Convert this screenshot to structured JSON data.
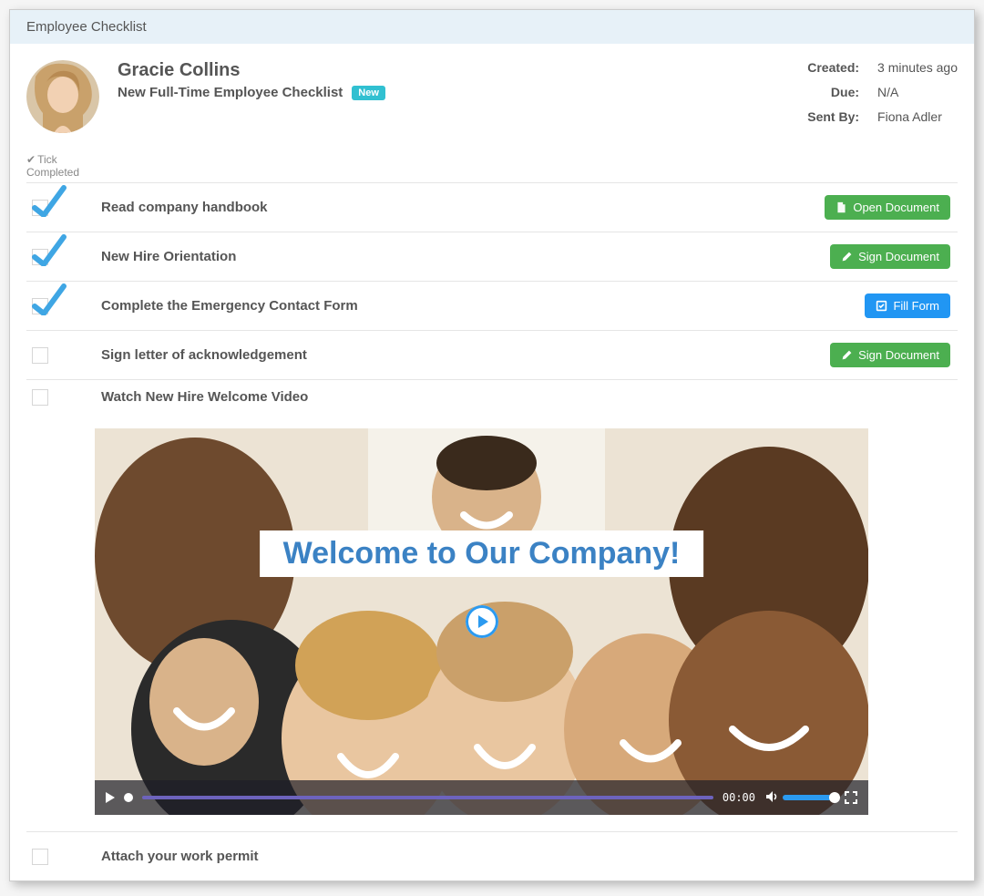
{
  "header": {
    "title": "Employee Checklist"
  },
  "profile": {
    "name": "Gracie Collins",
    "checklist_title": "New Full-Time Employee Checklist",
    "badge": "New"
  },
  "meta": {
    "created_label": "Created:",
    "created_value": "3 minutes ago",
    "due_label": "Due:",
    "due_value": "N/A",
    "sentby_label": "Sent By:",
    "sentby_value": "Fiona Adler"
  },
  "tick_col": {
    "line1": "Tick",
    "line2": "Completed"
  },
  "items": [
    {
      "title": "Read company handbook",
      "action": "Open Document",
      "action_style": "green",
      "action_icon": "file",
      "checked": true
    },
    {
      "title": "New Hire Orientation",
      "action": "Sign Document",
      "action_style": "green",
      "action_icon": "pencil",
      "checked": true
    },
    {
      "title": "Complete the Emergency Contact Form",
      "action": "Fill Form",
      "action_style": "blue",
      "action_icon": "form",
      "checked": true
    },
    {
      "title": "Sign letter of acknowledgement",
      "action": "Sign Document",
      "action_style": "green",
      "action_icon": "pencil",
      "checked": false
    },
    {
      "title": "Watch New Hire Welcome Video",
      "checked": false
    },
    {
      "title": "Attach your work permit",
      "checked": false
    }
  ],
  "video": {
    "title": "Welcome to Our Company!",
    "time": "00:00"
  }
}
